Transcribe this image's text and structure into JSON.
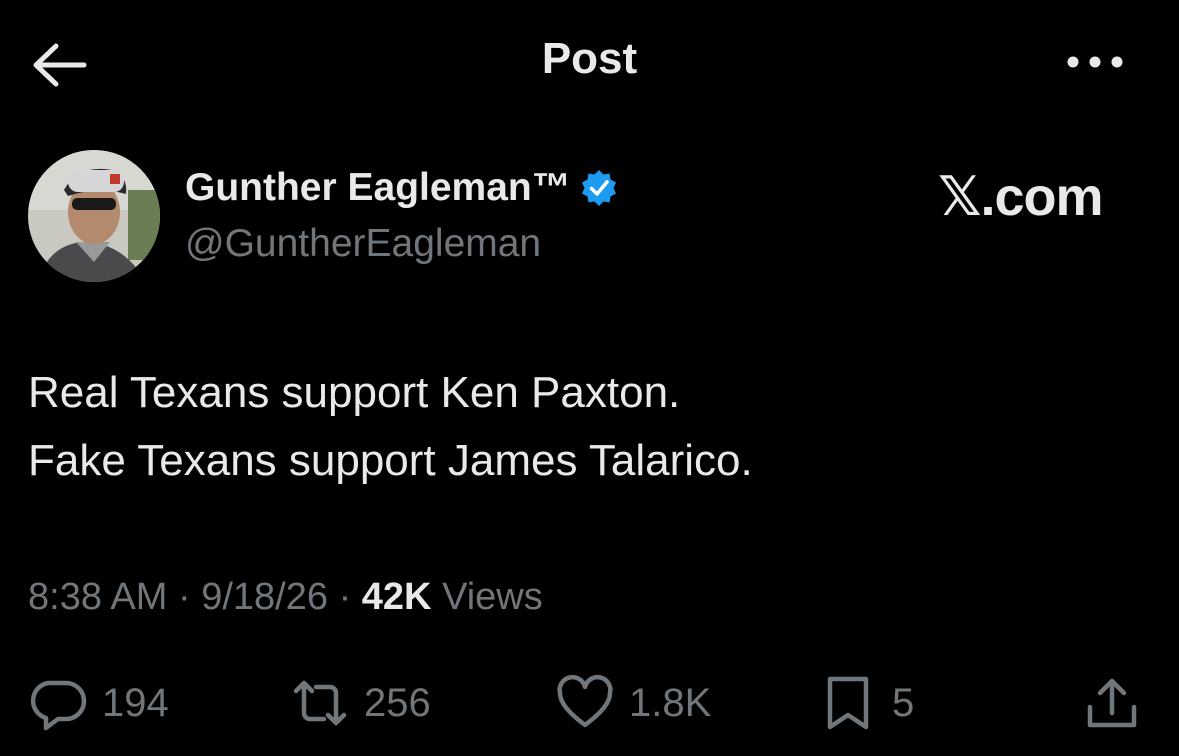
{
  "header": {
    "title": "Post",
    "back_icon": "arrow-left-icon",
    "more_icon": "more-horizontal-icon"
  },
  "author": {
    "name": "Gunther Eagleman™",
    "handle": "@GuntherEagleman",
    "verified": true,
    "verified_color": "#1d9bf0"
  },
  "watermark": "𝕏.com",
  "tweet": {
    "lines": [
      "Real Texans support Ken Paxton.",
      "Fake Texans support James Talarico."
    ]
  },
  "meta": {
    "time": "8:38 AM",
    "sep": "·",
    "date": "9/18/26",
    "views_count": "42K",
    "views_label": "Views"
  },
  "actions": {
    "replies": {
      "icon": "reply-icon",
      "count": "194"
    },
    "reposts": {
      "icon": "repost-icon",
      "count": "256"
    },
    "likes": {
      "icon": "heart-icon",
      "count": "1.8K"
    },
    "bookmarks": {
      "icon": "bookmark-icon",
      "count": "5"
    },
    "share": {
      "icon": "share-icon"
    }
  },
  "colors": {
    "background": "#000000",
    "text": "#e7e9ea",
    "muted": "#71767b",
    "accent": "#1d9bf0"
  }
}
